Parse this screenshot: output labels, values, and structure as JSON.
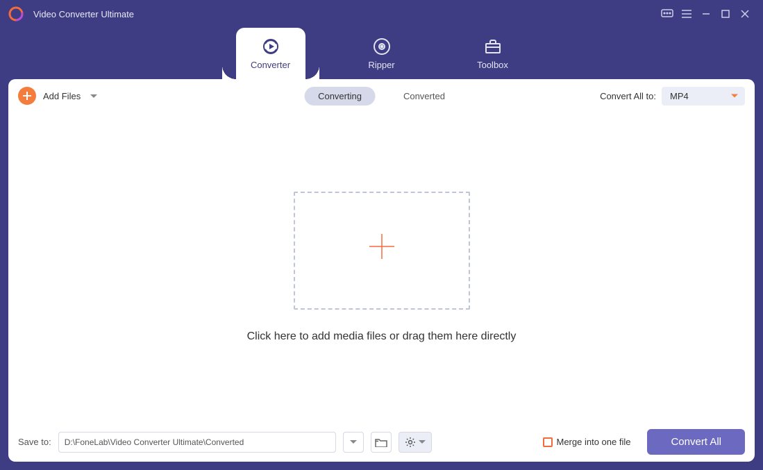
{
  "app": {
    "title": "Video Converter Ultimate"
  },
  "nav": {
    "tabs": [
      {
        "label": "Converter",
        "active": true
      },
      {
        "label": "Ripper",
        "active": false
      },
      {
        "label": "Toolbox",
        "active": false
      }
    ]
  },
  "toolbar": {
    "add_files_label": "Add Files",
    "sub_tabs": {
      "converting": "Converting",
      "converted": "Converted"
    },
    "convert_all_to_label": "Convert All to:",
    "selected_format": "MP4"
  },
  "dropzone": {
    "hint": "Click here to add media files or drag them here directly"
  },
  "bottom": {
    "save_to_label": "Save to:",
    "save_path": "D:\\FoneLab\\Video Converter Ultimate\\Converted",
    "merge_label": "Merge into one file",
    "convert_button": "Convert All"
  }
}
